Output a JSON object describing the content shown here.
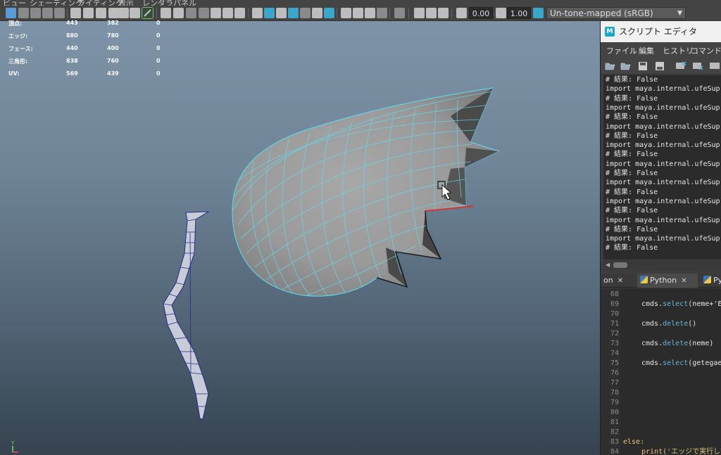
{
  "menu": {
    "items": [
      "ビュー",
      "シェーディング",
      "ライティング",
      "表示",
      "レンダラ",
      "パネル"
    ]
  },
  "toolbar": {
    "exposure_value": "0.00",
    "gamma_value": "1.00",
    "colorspace_label": "Un-tone-mapped (sRGB)"
  },
  "hud": {
    "rows": [
      {
        "label": "頂点:",
        "v1": "443",
        "v2": "382",
        "v3": "0"
      },
      {
        "label": "エッジ:",
        "v1": "880",
        "v2": "780",
        "v3": "0"
      },
      {
        "label": "フェース:",
        "v1": "440",
        "v2": "400",
        "v3": "0"
      },
      {
        "label": "三角形:",
        "v1": "838",
        "v2": "760",
        "v3": "0"
      },
      {
        "label": "UV:",
        "v1": "569",
        "v2": "439",
        "v3": "0"
      }
    ]
  },
  "axis": {
    "y_label": "Y"
  },
  "script_editor": {
    "title": "スクリプト エディタ",
    "logo": "M",
    "menu": [
      "ファイル",
      "編集",
      "ヒストリ",
      "コマンド"
    ],
    "history_lines": [
      "# 結果: False",
      "import maya.internal.ufeSup",
      "# 結果: False",
      "import maya.internal.ufeSup",
      "# 結果: False",
      "import maya.internal.ufeSup",
      "# 結果: False",
      "import maya.internal.ufeSup",
      "# 結果: False",
      "import maya.internal.ufeSup",
      "# 結果: False",
      "import maya.internal.ufeSup",
      "# 結果: False",
      "import maya.internal.ufeSup",
      "# 結果: False",
      "import maya.internal.ufeSup",
      "# 結果: False",
      "import maya.internal.ufeSup",
      "# 結果: False"
    ],
    "tabs": [
      {
        "label": "on",
        "close": "✕"
      },
      {
        "label": "Python",
        "close": "✕"
      },
      {
        "label": "Py",
        "close": ""
      }
    ],
    "line_numbers": [
      "68",
      "69",
      "70",
      "71",
      "72",
      "73",
      "74",
      "75",
      "76",
      "77",
      "78",
      "79",
      "80",
      "81",
      "82",
      "83",
      "84"
    ],
    "code": {
      "l69_obj": "cmds.",
      "l69_fn": "select",
      "l69_rest": "(neme+'E",
      "l71_obj": "cmds.",
      "l71_fn": "delete",
      "l71_rest": "()",
      "l73_obj": "cmds.",
      "l73_fn": "delete",
      "l73_rest": "(neme)",
      "l75_obj": "cmds.",
      "l75_fn": "select",
      "l75_rest": "(getegae",
      "l83_kw": "else:",
      "l84_kw": "print",
      "l84_str": "('エッジで実行して"
    }
  }
}
